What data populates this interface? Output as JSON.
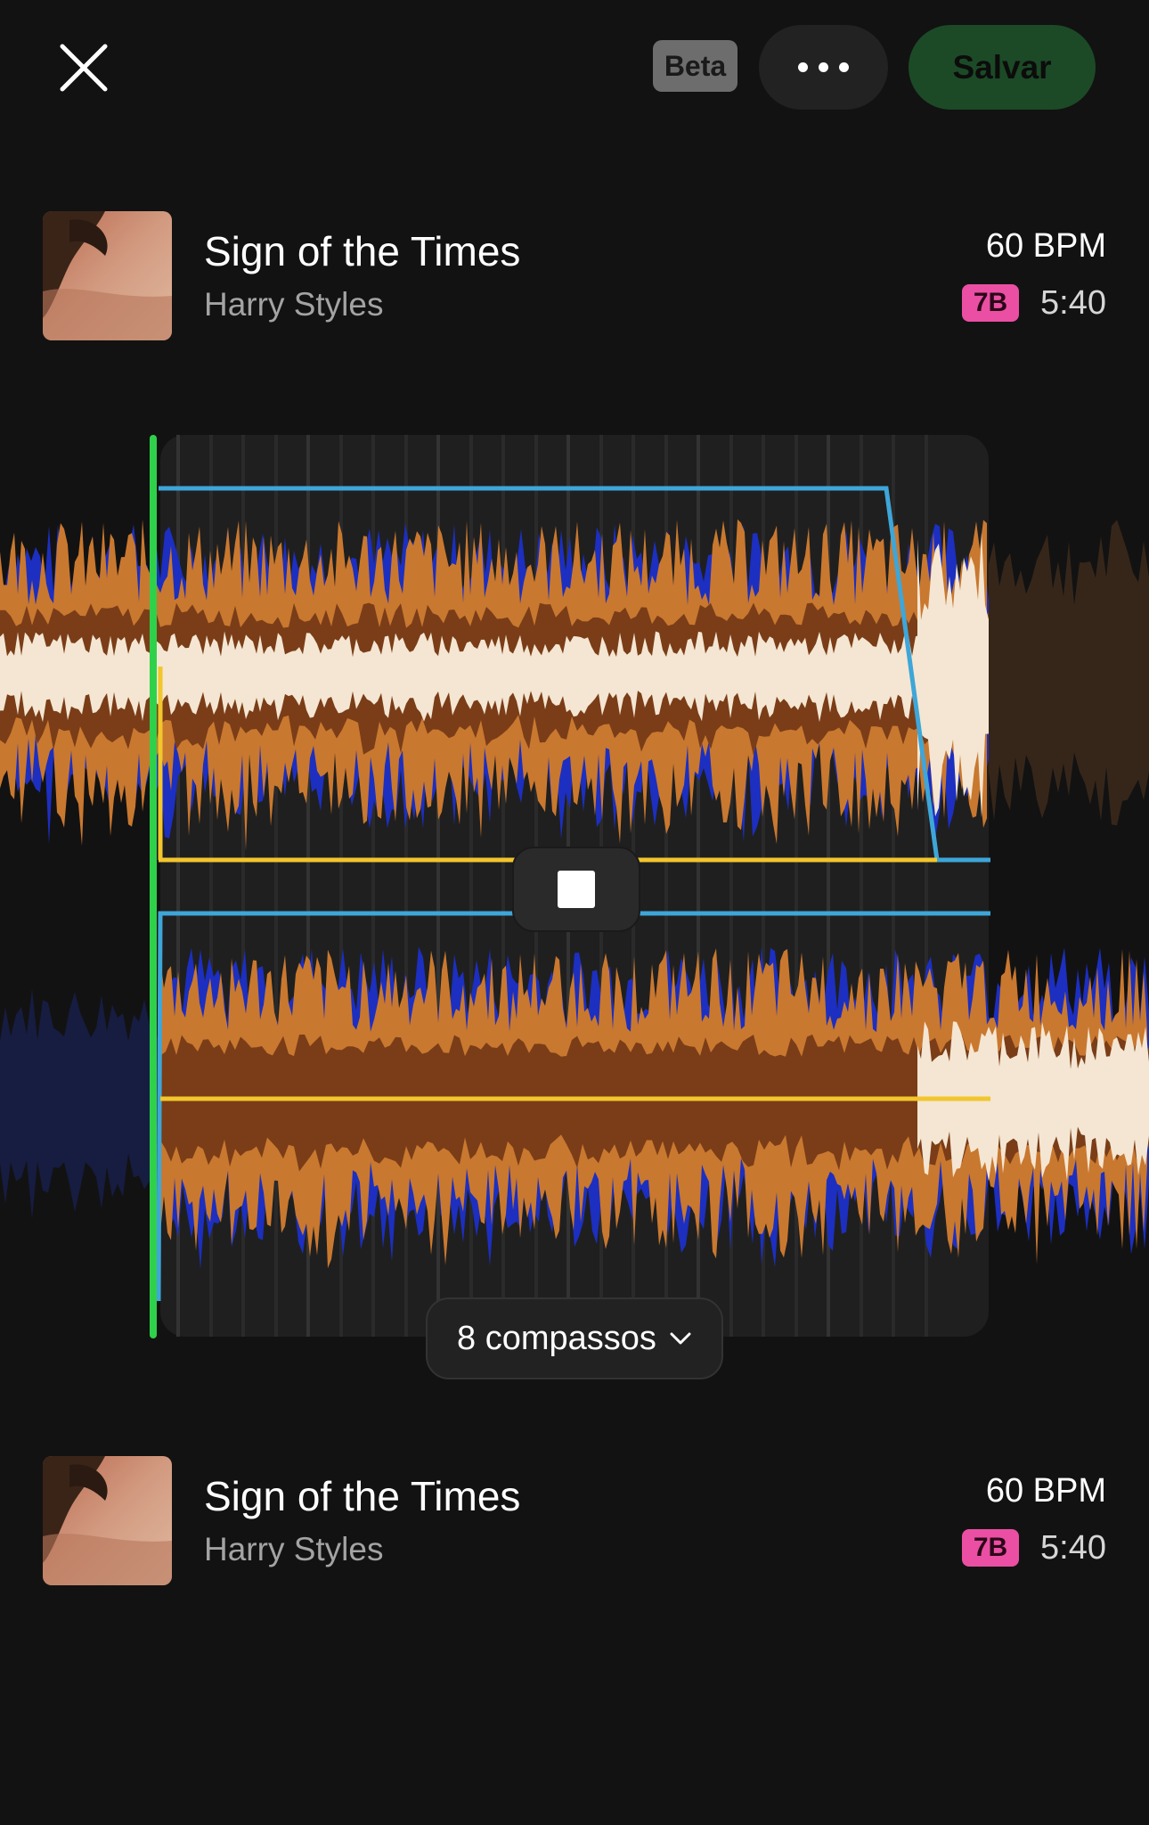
{
  "toolbar": {
    "beta_label": "Beta",
    "save_label": "Salvar"
  },
  "tracks": [
    {
      "title": "Sign of the Times",
      "artist": "Harry Styles",
      "bpm": "60 BPM",
      "key": "7B",
      "duration": "5:40"
    },
    {
      "title": "Sign of the Times",
      "artist": "Harry Styles",
      "bpm": "60 BPM",
      "key": "7B",
      "duration": "5:40"
    }
  ],
  "editor": {
    "bars_label": "8 compassos"
  },
  "colors": {
    "accent_save": "#1c4a26",
    "playhead": "#2fd14a",
    "wave_low": "#7a3d18",
    "wave_mid": "#c9782f",
    "wave_high": "#1c2fc0",
    "wave_core": "#f4e6d2",
    "volume_curve": "#3ea6d8",
    "eq_curve": "#f2c62c",
    "key_badge": "#ea4fa3"
  },
  "icons": {
    "close": "close-icon",
    "more": "more-icon",
    "stop": "stop-icon",
    "chevron": "chevron-down-icon"
  }
}
